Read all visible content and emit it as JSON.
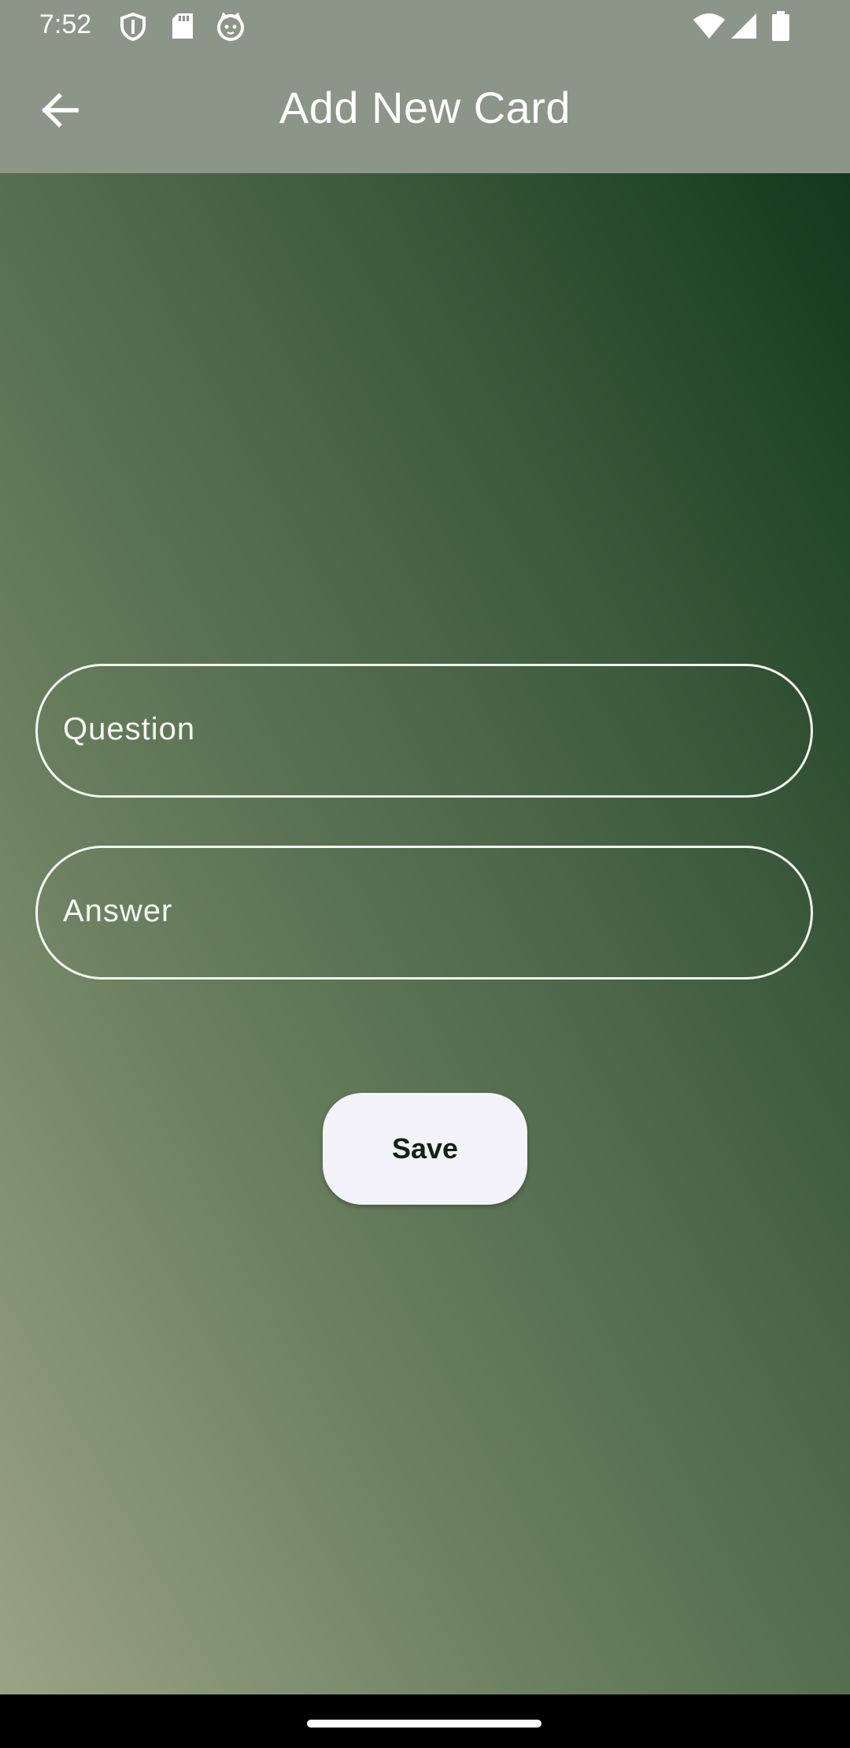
{
  "status_bar": {
    "time": "7:52",
    "left_icons": [
      "shield-icon",
      "sd-card-icon",
      "android-cat-icon"
    ],
    "right_icons": [
      "wifi-icon",
      "cellular-signal-icon",
      "battery-icon"
    ]
  },
  "app_bar": {
    "title": "Add New Card",
    "back_icon": "arrow-back-icon"
  },
  "form": {
    "question_placeholder": "Question",
    "answer_placeholder": "Answer",
    "save_label": "Save"
  },
  "colors": {
    "app_bar_background": "#8b9588",
    "gradient_dark": "#13381b",
    "gradient_light": "#9aa386",
    "field_border": "#f3f5f0",
    "button_background": "#f4f3f9"
  }
}
